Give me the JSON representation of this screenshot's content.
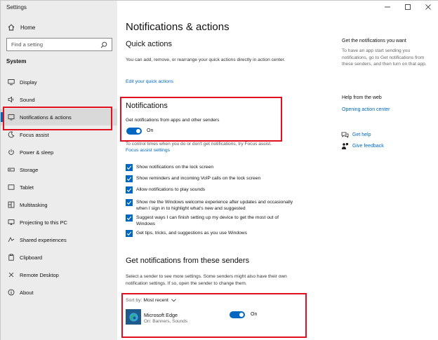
{
  "window": {
    "title": "Settings",
    "controls": {
      "minimize": "minimize",
      "maximize": "maximize",
      "close": "close"
    }
  },
  "sidebar": {
    "home_label": "Home",
    "search_placeholder": "Find a setting",
    "section_heading": "System",
    "items": [
      {
        "label": "Display",
        "icon": "display-icon"
      },
      {
        "label": "Sound",
        "icon": "speaker-icon"
      },
      {
        "label": "Notifications & actions",
        "icon": "notification-icon",
        "selected": true
      },
      {
        "label": "Focus assist",
        "icon": "moon-icon"
      },
      {
        "label": "Power & sleep",
        "icon": "power-icon"
      },
      {
        "label": "Storage",
        "icon": "drive-icon"
      },
      {
        "label": "Tablet",
        "icon": "tablet-icon"
      },
      {
        "label": "Multitasking",
        "icon": "multitasking-icon"
      },
      {
        "label": "Projecting to this PC",
        "icon": "projecting-icon"
      },
      {
        "label": "Shared experiences",
        "icon": "shared-icon"
      },
      {
        "label": "Clipboard",
        "icon": "clipboard-icon"
      },
      {
        "label": "Remote Desktop",
        "icon": "remote-desktop-icon"
      },
      {
        "label": "About",
        "icon": "info-icon"
      }
    ]
  },
  "main": {
    "page_title": "Notifications & actions",
    "quick_actions": {
      "heading": "Quick actions",
      "description": "You can add, remove, or rearrange your quick actions directly in action center.",
      "edit_link": "Edit your quick actions"
    },
    "notifications": {
      "heading": "Notifications",
      "toggle_caption": "Get notifications from apps and other senders",
      "toggle_state": "On",
      "focus_text": "To control times when you do or don't get notifications, try Focus assist.",
      "focus_link": "Focus assist settings",
      "checkboxes": [
        {
          "label": "Show notifications on the lock screen",
          "checked": true
        },
        {
          "label": "Show reminders and incoming VoIP calls on the lock screen",
          "checked": true
        },
        {
          "label": "Allow notifications to play sounds",
          "checked": true
        },
        {
          "label": "Show me the Windows welcome experience after updates and occasionally when I sign in to highlight what's new and suggested",
          "checked": true
        },
        {
          "label": "Suggest ways I can finish setting up my device to get the most out of Windows",
          "checked": true
        },
        {
          "label": "Get tips, tricks, and suggestions as you use Windows",
          "checked": true
        }
      ]
    },
    "senders": {
      "heading": "Get notifications from these senders",
      "description": "Select a sender to see more settings. Some senders might also have their own notification settings. If so, open the sender to change them.",
      "sort_label": "Sort by:",
      "sort_value": "Most recent",
      "items": [
        {
          "name": "Microsoft Edge",
          "subtitle": "On: Banners, Sounds",
          "state": "On",
          "icon": "edge-icon"
        }
      ]
    }
  },
  "aside": {
    "get_heading": "Get the notifications you want",
    "get_text": "To have an app start sending you notifications, go to Get notifications from these senders, and then turn on that app.",
    "help_heading": "Help from the web",
    "help_link": "Opening action center",
    "get_help": "Get help",
    "give_feedback": "Give feedback"
  },
  "colors": {
    "accent": "#0067c0",
    "highlight": "#e0101e",
    "sidebar_bg": "#ececec"
  }
}
